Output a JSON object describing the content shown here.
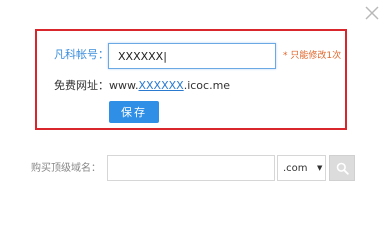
{
  "dialog": {
    "close_icon": "close-icon"
  },
  "account": {
    "label": "凡科帐号：",
    "value": "XXXXXX|",
    "hint": "* 只能修改1次"
  },
  "free_url": {
    "label": "免费网址：",
    "prefix": "www.",
    "link_text": "XXXXXX",
    "suffix": ".icoc.me"
  },
  "save_button": {
    "label": "保存"
  },
  "buy_domain": {
    "label": "购买顶级域名：",
    "input_value": "",
    "tld_selected": ".com",
    "search_icon": "search-icon"
  },
  "colors": {
    "highlight_border": "#d9262c",
    "accent_blue": "#2f8fe6",
    "hint_orange": "#e0662b"
  }
}
